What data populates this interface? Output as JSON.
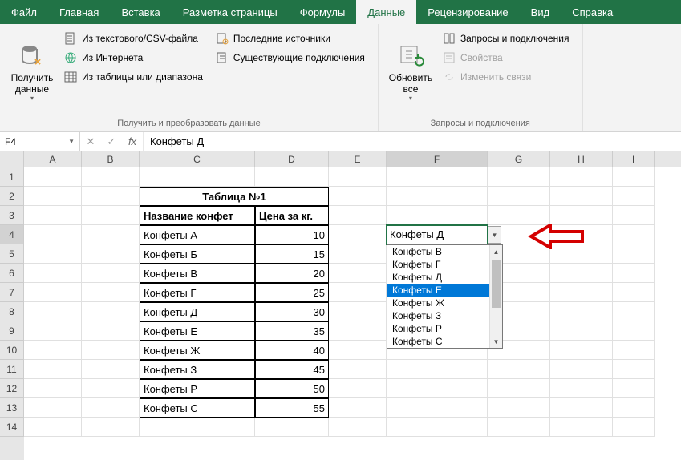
{
  "tabs": [
    "Файл",
    "Главная",
    "Вставка",
    "Разметка страницы",
    "Формулы",
    "Данные",
    "Рецензирование",
    "Вид",
    "Справка"
  ],
  "active_tab": 5,
  "ribbon": {
    "group1": {
      "big": {
        "label": "Получить данные",
        "caret": "▾"
      },
      "items": [
        "Из текстового/CSV-файла",
        "Из Интернета",
        "Из таблицы или диапазона",
        "Последние источники",
        "Существующие подключения"
      ],
      "label": "Получить и преобразовать данные"
    },
    "group2": {
      "big": {
        "label": "Обновить все",
        "caret": "▾"
      },
      "items": [
        "Запросы и подключения",
        "Свойства",
        "Изменить связи"
      ],
      "label": "Запросы и подключения"
    }
  },
  "namebox": "F4",
  "formula": "Конфеты Д",
  "columns": [
    "A",
    "B",
    "C",
    "D",
    "E",
    "F",
    "G",
    "H",
    "I"
  ],
  "rows": 14,
  "table": {
    "title": "Таблица №1",
    "headers": [
      "Название конфет",
      "Цена за кг."
    ],
    "data": [
      [
        "Конфеты А",
        "10"
      ],
      [
        "Конфеты Б",
        "15"
      ],
      [
        "Конфеты В",
        "20"
      ],
      [
        "Конфеты Г",
        "25"
      ],
      [
        "Конфеты Д",
        "30"
      ],
      [
        "Конфеты Е",
        "35"
      ],
      [
        "Конфеты Ж",
        "40"
      ],
      [
        "Конфеты З",
        "45"
      ],
      [
        "Конфеты Р",
        "50"
      ],
      [
        "Конфеты С",
        "55"
      ]
    ]
  },
  "cellF4": "Конфеты Д",
  "dropdown": {
    "items": [
      "Конфеты В",
      "Конфеты Г",
      "Конфеты Д",
      "Конфеты Е",
      "Конфеты Ж",
      "Конфеты З",
      "Конфеты Р",
      "Конфеты С"
    ],
    "highlighted": 3
  }
}
